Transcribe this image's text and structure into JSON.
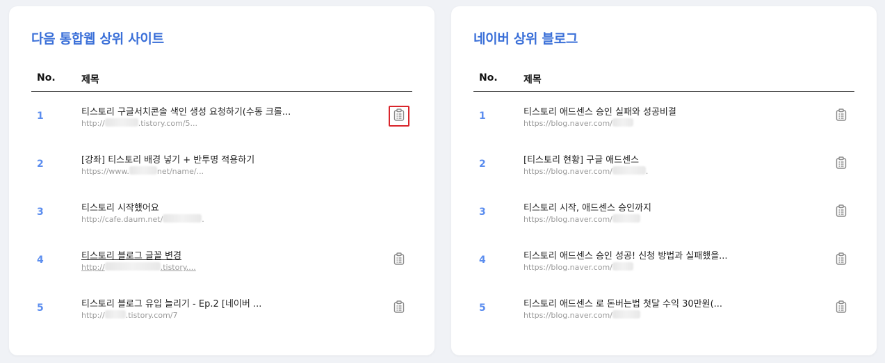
{
  "colors": {
    "accent": "#3a6fd8",
    "row_number": "#5b8def",
    "highlight": "#d9252b"
  },
  "left_panel": {
    "title": "다음 통합웹 상위 사이트",
    "col_no": "No.",
    "col_title": "제목",
    "rows": [
      {
        "num": "1",
        "title": "티스토리 구글서치콘솔 색인 생성 요청하기(수동 크롤...",
        "url_pre": "http://",
        "url_post": ".tistory.com/5..."
      },
      {
        "num": "2",
        "title": "[강좌] 티스토리 배경 넣기 + 반투명 적용하기",
        "url_pre": "https://www.",
        "url_post": "net/name/..."
      },
      {
        "num": "3",
        "title": "티스토리 시작했어요",
        "url_pre": "http://cafe.daum.net/",
        "url_post": "."
      },
      {
        "num": "4",
        "title": "티스토리 블로그 글꼴 변경",
        "url_pre": "http://",
        "url_post": ".tistory...."
      },
      {
        "num": "5",
        "title": "티스토리 블로그 유입 늘리기 - Ep.2 [네이버 ...",
        "url_pre": "http://",
        "url_post": ".tistory.com/7"
      }
    ]
  },
  "right_panel": {
    "title": "네이버 상위 블로그",
    "col_no": "No.",
    "col_title": "제목",
    "rows": [
      {
        "num": "1",
        "title": "티스토리 애드센스 승인 실패와 성공비결",
        "url_pre": "https://blog.naver.com/",
        "url_post": ""
      },
      {
        "num": "2",
        "title": "[티스토리 현황] 구글 애드센스",
        "url_pre": "https://blog.naver.com/",
        "url_post": "."
      },
      {
        "num": "3",
        "title": "티스토리 시작, 애드센스 승인까지",
        "url_pre": "https://blog.naver.com/",
        "url_post": ""
      },
      {
        "num": "4",
        "title": "티스토리 애드센스 승인 성공! 신청 방법과 실패했을...",
        "url_pre": "https://blog.naver.com/",
        "url_post": ""
      },
      {
        "num": "5",
        "title": "티스토리 애드센스 로 돈버는법 첫달 수익 30만원(...",
        "url_pre": "https://blog.naver.com/",
        "url_post": ""
      }
    ]
  },
  "icons": {
    "copy": "clipboard-icon"
  }
}
